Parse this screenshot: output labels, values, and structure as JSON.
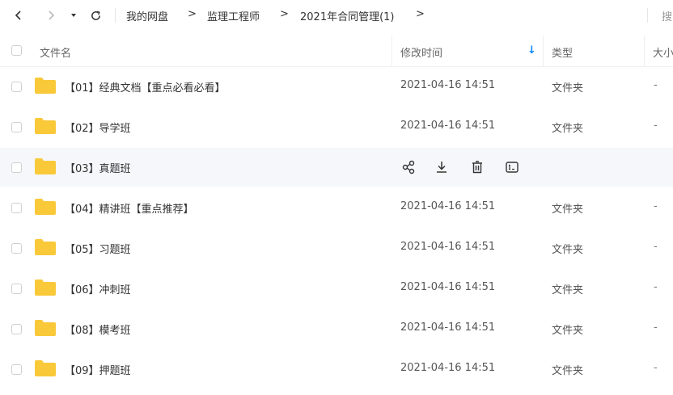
{
  "breadcrumb": {
    "items": [
      "我的网盘",
      "监理工程师",
      "2021年合同管理(1)"
    ],
    "separator": ">",
    "search_label_partial": "搜"
  },
  "header": {
    "col_name": "文件名",
    "col_modified": "修改时间",
    "col_type": "类型",
    "col_size_partial": "大小",
    "sort_arrow": "↓"
  },
  "files": [
    {
      "name": "【01】经典文档【重点必看必看】",
      "modified": "2021-04-16 14:51",
      "type": "文件夹",
      "size": "-"
    },
    {
      "name": "【02】导学班",
      "modified": "2021-04-16 14:51",
      "type": "文件夹",
      "size": "-"
    },
    {
      "name": "【03】真题班",
      "modified": "",
      "type": "",
      "size": ""
    },
    {
      "name": "【04】精讲班【重点推荐】",
      "modified": "2021-04-16 14:51",
      "type": "文件夹",
      "size": "-"
    },
    {
      "name": "【05】习题班",
      "modified": "2021-04-16 14:51",
      "type": "文件夹",
      "size": "-"
    },
    {
      "name": "【06】冲刺班",
      "modified": "2021-04-16 14:51",
      "type": "文件夹",
      "size": "-"
    },
    {
      "name": "【08】模考班",
      "modified": "2021-04-16 14:51",
      "type": "文件夹",
      "size": "-"
    },
    {
      "name": "【09】押题班",
      "modified": "2021-04-16 14:51",
      "type": "文件夹",
      "size": "-"
    }
  ],
  "colors": {
    "folder": "#f9c93a",
    "accent": "#0a84ff",
    "hover_row": "#f5f7fa"
  }
}
